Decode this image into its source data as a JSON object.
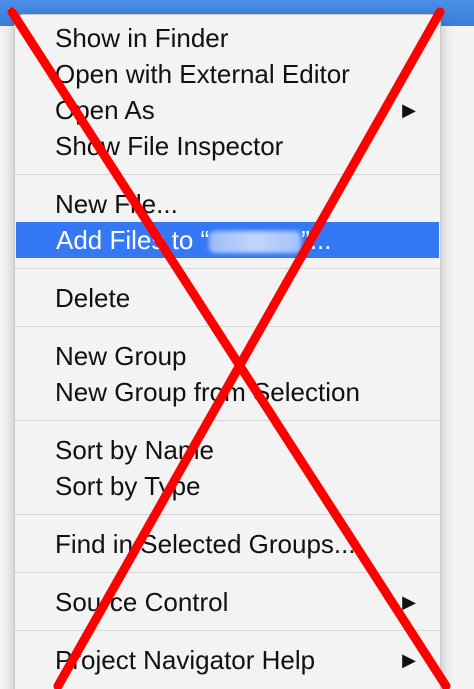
{
  "menu": {
    "group1": [
      {
        "label": "Show in Finder"
      },
      {
        "label": "Open with External Editor"
      },
      {
        "label": "Open As",
        "arrow": "▶"
      },
      {
        "label": "Show File Inspector"
      }
    ],
    "group2": [
      {
        "label": "New File..."
      },
      {
        "label_prefix": "Add Files to “",
        "label_suffix": "”..."
      }
    ],
    "group3": [
      {
        "label": "Delete"
      }
    ],
    "group4": [
      {
        "label": "New Group"
      },
      {
        "label": "New Group from Selection"
      }
    ],
    "group5": [
      {
        "label": "Sort by Name"
      },
      {
        "label": "Sort by Type"
      }
    ],
    "group6": [
      {
        "label": "Find in Selected Groups..."
      }
    ],
    "group7": [
      {
        "label": "Source Control",
        "arrow": "▶"
      }
    ],
    "group8": [
      {
        "label": "Project Navigator Help",
        "arrow": "▶"
      }
    ]
  },
  "colors": {
    "highlight": "#3478f6",
    "overlay_x": "#ff0000"
  }
}
